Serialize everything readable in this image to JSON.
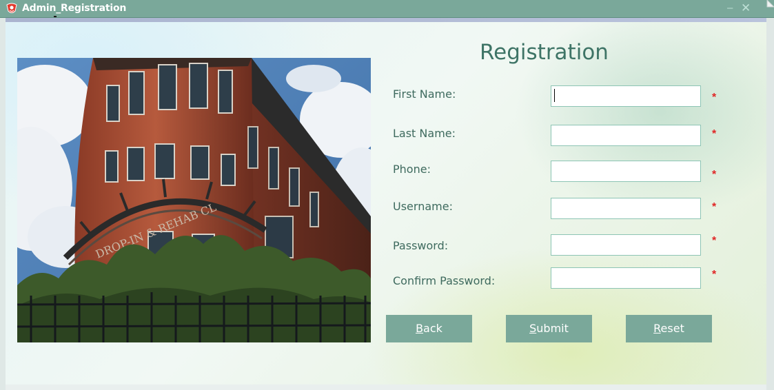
{
  "window": {
    "title": "Admin_Registration",
    "minimize_glyph": "–",
    "close_glyph": "✕",
    "app_icon": "app-logo-icon"
  },
  "photo": {
    "sign_text": "DROP-IN & REHAB CL"
  },
  "form": {
    "heading": "Registration",
    "required_marker": "*",
    "fields": [
      {
        "label": "First Name:",
        "value": ""
      },
      {
        "label": "Last Name:",
        "value": ""
      },
      {
        "label": "Phone:",
        "value": ""
      },
      {
        "label": "Username:",
        "value": ""
      },
      {
        "label": "Password:",
        "value": ""
      },
      {
        "label": "Confirm Password:",
        "value": ""
      }
    ]
  },
  "buttons": {
    "back": {
      "mnemonic": "B",
      "rest": "ack"
    },
    "submit": {
      "mnemonic": "S",
      "rest": "ubmit"
    },
    "reset": {
      "mnemonic": "R",
      "rest": "eset"
    }
  },
  "colors": {
    "titlebar": "#7aa89a",
    "button": "#7aa89a",
    "heading": "#3e7466",
    "required": "#e02424"
  }
}
